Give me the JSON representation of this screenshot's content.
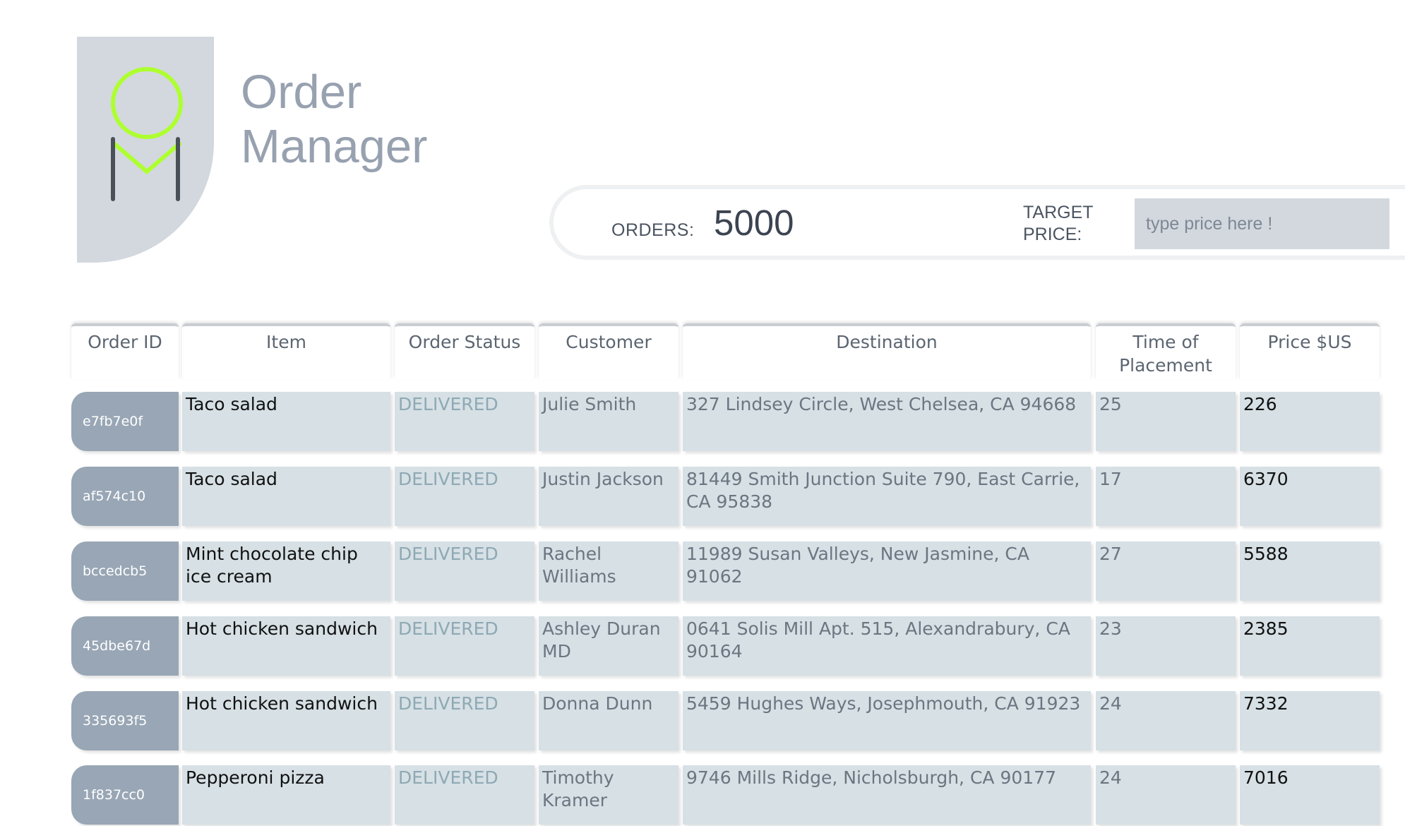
{
  "app": {
    "title_line1": "Order",
    "title_line2": "Manager"
  },
  "colors": {
    "logo_accent": "#adff2f",
    "logo_stroke": "#4a5058",
    "id_cell_bg": "#98a6b5",
    "cell_bg": "#d6e0e5",
    "status_text": "#8ea9b4"
  },
  "summary": {
    "orders_label": "ORDERS:",
    "orders_count": "5000",
    "target_label": "TARGET PRICE:",
    "target_placeholder": "type price here !",
    "target_value": ""
  },
  "table": {
    "columns": [
      "Order ID",
      "Item",
      "Order Status",
      "Customer",
      "Destination",
      "Time of Placement",
      "Price $US"
    ],
    "rows": [
      [
        "e7fb7e0f",
        "Taco salad",
        "DELIVERED",
        "Julie Smith",
        "327 Lindsey Circle, West Chelsea, CA 94668",
        "25",
        "226"
      ],
      [
        "af574c10",
        "Taco salad",
        "DELIVERED",
        "Justin Jackson",
        "81449 Smith Junction Suite 790, East Carrie, CA 95838",
        "17",
        "6370"
      ],
      [
        "bccedcb5",
        "Mint chocolate chip ice cream",
        "DELIVERED",
        "Rachel Williams",
        "11989 Susan Valleys, New Jasmine, CA 91062",
        "27",
        "5588"
      ],
      [
        "45dbe67d",
        "Hot chicken sandwich",
        "DELIVERED",
        "Ashley Duran MD",
        "0641 Solis Mill Apt. 515, Alexandrabury, CA 90164",
        "23",
        "2385"
      ],
      [
        "335693f5",
        "Hot chicken sandwich",
        "DELIVERED",
        "Donna Dunn",
        "5459 Hughes Ways, Josephmouth, CA 91923",
        "24",
        "7332"
      ],
      [
        "1f837cc0",
        "Pepperoni pizza",
        "DELIVERED",
        "Timothy Kramer",
        "9746 Mills Ridge, Nicholsburgh, CA 90177",
        "24",
        "7016"
      ]
    ]
  }
}
